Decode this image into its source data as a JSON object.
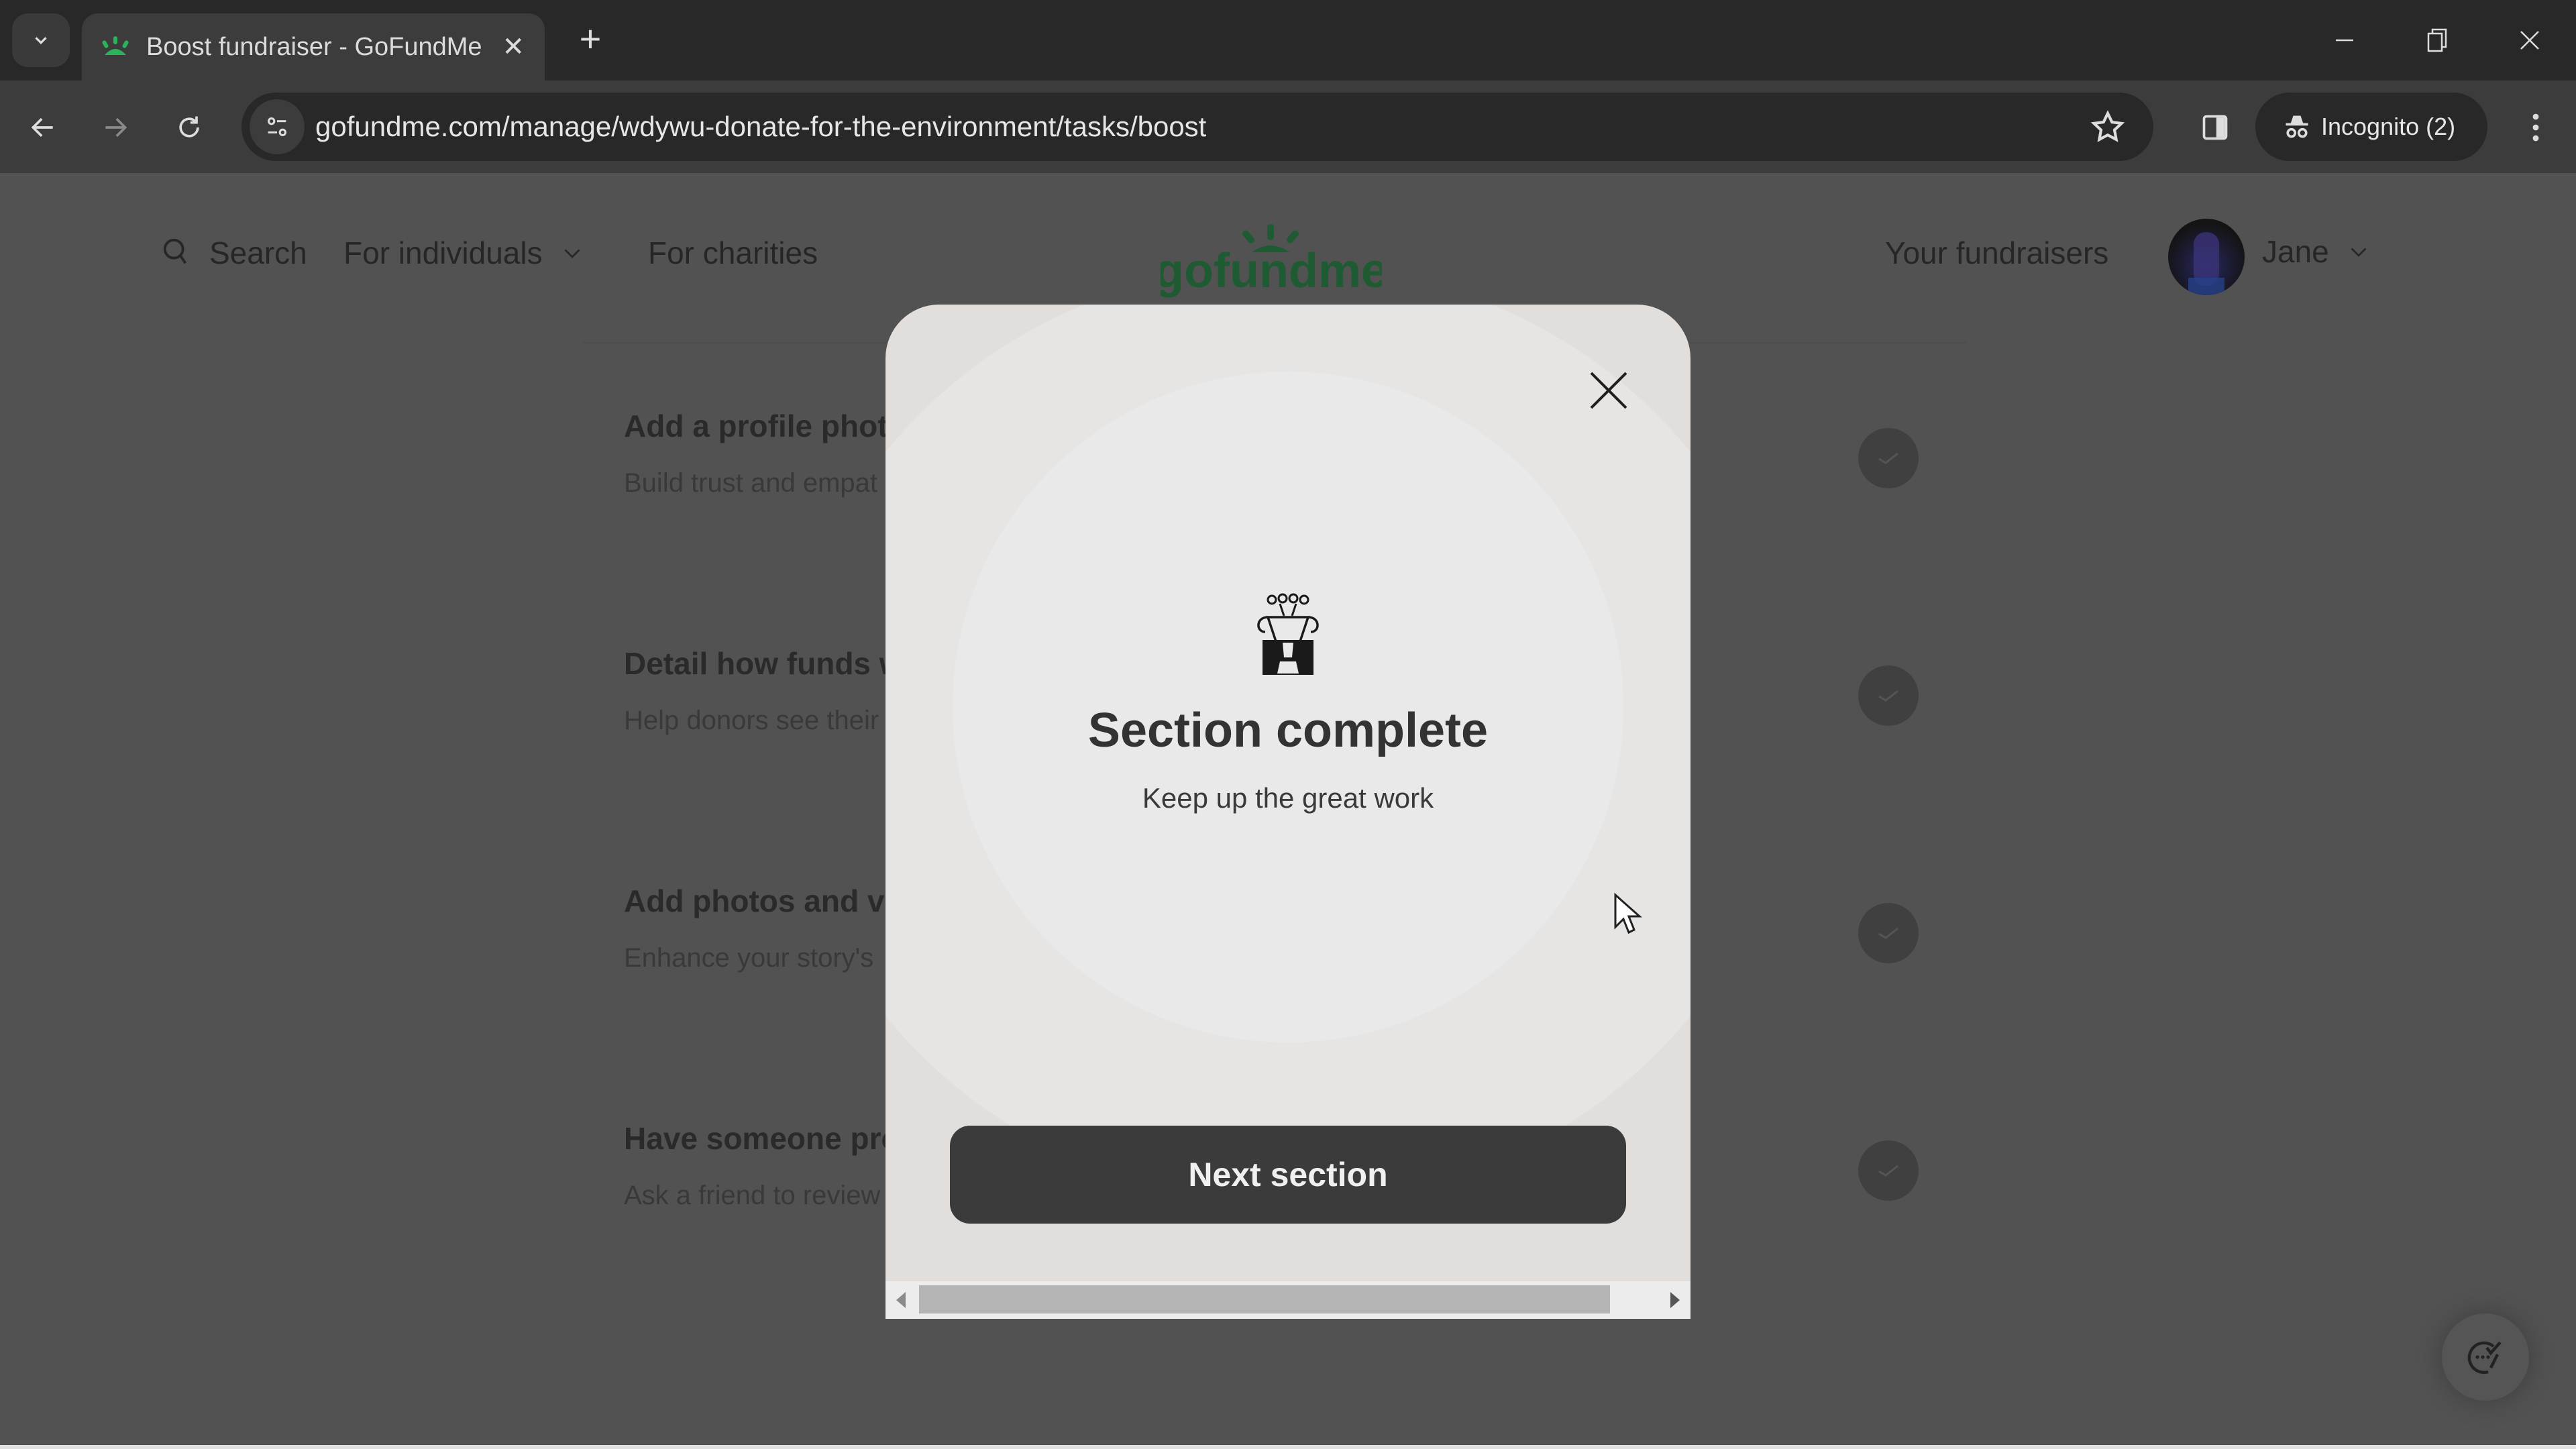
{
  "browser": {
    "tab": {
      "title": "Boost fundraiser - GoFundMe"
    },
    "new_tab_label": "+",
    "url": "gofundme.com/manage/wdywu-donate-for-the-environment/tasks/boost",
    "profile_label": "Incognito (2)",
    "colors": {
      "favicon": "#2cb35a"
    }
  },
  "header": {
    "search_label": "Search",
    "for_individuals_label": "For individuals",
    "for_charities_label": "For charities",
    "logo_text": "gofundme",
    "your_fundraisers_label": "Your fundraisers",
    "user_name": "Jane",
    "colors": {
      "logo": "#1e5a32"
    }
  },
  "tasks": [
    {
      "title": "Add a profile phot",
      "description": "Build trust and empat",
      "completed": true
    },
    {
      "title": "Detail how funds w",
      "description": "Help donors see their",
      "completed": true
    },
    {
      "title": "Add photos and vi",
      "description": "Enhance your story's",
      "completed": true
    },
    {
      "title": "Have someone pro",
      "description": "Ask a friend to review",
      "completed": true
    }
  ],
  "modal": {
    "title": "Section complete",
    "subtitle": "Keep up the great work",
    "next_button_label": "Next section"
  }
}
